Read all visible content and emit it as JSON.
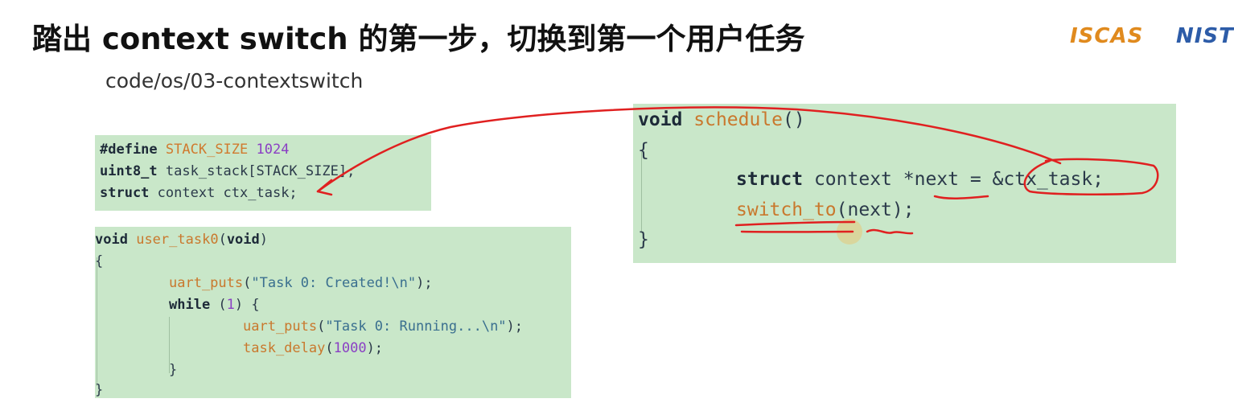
{
  "slide": {
    "title": "踏出 context switch 的第一步，切换到第一个用户任务",
    "path": "code/os/03-contextswitch"
  },
  "logos": {
    "iscas": "ISCAS",
    "nist": "NIST"
  },
  "code": {
    "defines": {
      "line1": {
        "kw": "#define",
        "macro": "STACK_SIZE",
        "num": "1024"
      },
      "line2": {
        "kw": "uint8_t",
        "rest": "task_stack[STACK_SIZE];"
      },
      "line3": {
        "kw": "struct",
        "rest": "context ctx_task;"
      }
    },
    "user_task": {
      "line1": {
        "kw": "void",
        "fn": "user_task0",
        "open": "(",
        "kw2": "void",
        "close": ")"
      },
      "line2": "{",
      "line3": {
        "fn": "uart_puts",
        "open": "(",
        "str": "\"Task 0: Created!\\n\"",
        "close": ");"
      },
      "line4": {
        "kw": "while",
        "open": " (",
        "num": "1",
        "close": ") {"
      },
      "line5": {
        "fn": "uart_puts",
        "open": "(",
        "str": "\"Task 0: Running...\\n\"",
        "close": ");"
      },
      "line6": {
        "fn": "task_delay",
        "open": "(",
        "num": "1000",
        "close": ");"
      },
      "line7": "}",
      "line8": "}"
    },
    "schedule": {
      "line1": {
        "kw": "void",
        "fn": "schedule",
        "parens": "()"
      },
      "line2": "{",
      "line3": {
        "kw": "struct",
        "rest": "context",
        "star": "*next = &ctx_task;"
      },
      "line4": {
        "fn": "switch_to",
        "rest": "(next);"
      },
      "line5": "}"
    }
  },
  "colors": {
    "code_bg": "#c9e7c9",
    "annotation_red": "#e02020",
    "logo_orange": "#e08a1e",
    "logo_blue": "#2d5ca8"
  }
}
